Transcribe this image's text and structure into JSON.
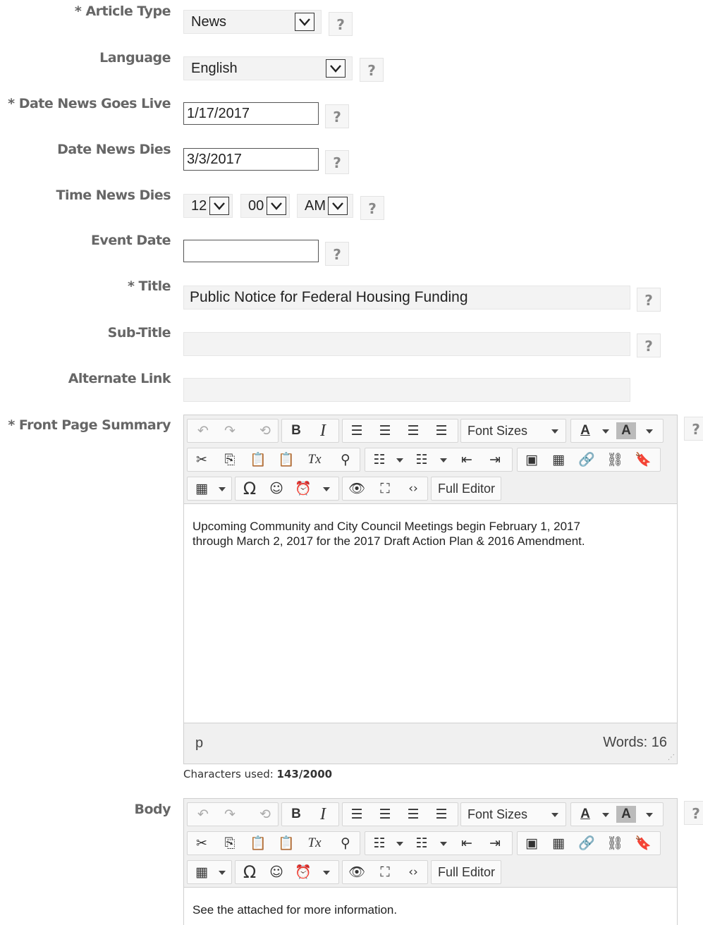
{
  "form": {
    "article_type": {
      "label": "* Article Type",
      "value": "News"
    },
    "language": {
      "label": "Language",
      "value": "English"
    },
    "date_live": {
      "label": "* Date News Goes Live",
      "value": "1/17/2017"
    },
    "date_dies": {
      "label": "Date News Dies",
      "value": "3/3/2017"
    },
    "time_dies": {
      "label": "Time News Dies",
      "hour": "12",
      "minute": "00",
      "ampm": "AM"
    },
    "event_date": {
      "label": "Event Date",
      "value": ""
    },
    "title": {
      "label": "* Title",
      "value": "Public Notice for Federal Housing Funding"
    },
    "subtitle": {
      "label": "Sub-Title",
      "value": ""
    },
    "alternate_link": {
      "label": "Alternate Link",
      "value": ""
    },
    "summary": {
      "label": "* Front Page Summary",
      "content_line1": "Upcoming Community and City Council Meetings begin February 1,  2017",
      "content_line2": "through March 2, 2017 for the 2017 Draft Action Plan & 2016 Amendment.",
      "path": "p",
      "words": "Words: 16",
      "chars_label": "Characters used: ",
      "chars_value": "143/2000"
    },
    "body": {
      "label": "Body",
      "content_line1": "See the attached for more information."
    }
  },
  "help_label": "?",
  "toolbar": {
    "font_sizes": "Font Sizes",
    "full_editor": "Full Editor",
    "text_color": "A",
    "bg_color": "A"
  },
  "icons": {
    "undo": "undo-icon",
    "redo": "redo-icon",
    "restore": "restore-draft-icon",
    "bold": "bold-icon",
    "italic": "italic-icon"
  }
}
